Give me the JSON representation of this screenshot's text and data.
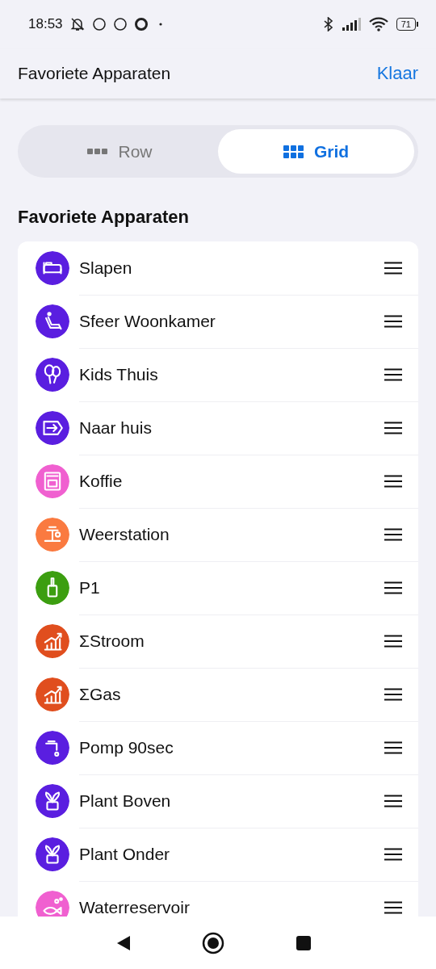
{
  "status_bar": {
    "time": "18:53",
    "battery": "71"
  },
  "header": {
    "title": "Favoriete Apparaten",
    "action": "Klaar"
  },
  "view_toggle": [
    {
      "label": "Row",
      "kind": "row",
      "selected": false
    },
    {
      "label": "Grid",
      "kind": "grid",
      "selected": true
    }
  ],
  "section_title": "Favoriete Apparaten",
  "devices": [
    {
      "name": "Slapen",
      "kind": "bed",
      "color": "#5a1ee0"
    },
    {
      "name": "Sfeer Woonkamer",
      "kind": "recliner",
      "color": "#5a1ee0"
    },
    {
      "name": "Kids Thuis",
      "kind": "balloon",
      "color": "#5a1ee0"
    },
    {
      "name": "Naar huis",
      "kind": "sign",
      "color": "#5a1ee0"
    },
    {
      "name": "Koffie",
      "kind": "coffee",
      "color": "#f060d0"
    },
    {
      "name": "Weerstation",
      "kind": "weather",
      "color": "#fa7a40"
    },
    {
      "name": "P1",
      "kind": "plug",
      "color": "#3c9e10"
    },
    {
      "name": "ΣStroom",
      "kind": "chart",
      "color": "#e04e1e"
    },
    {
      "name": "ΣGas",
      "kind": "chart",
      "color": "#e04e1e"
    },
    {
      "name": "Pomp 90sec",
      "kind": "tap",
      "color": "#5a1ee0"
    },
    {
      "name": "Plant Boven",
      "kind": "plant",
      "color": "#5a1ee0"
    },
    {
      "name": "Plant Onder",
      "kind": "plant",
      "color": "#5a1ee0"
    },
    {
      "name": "Waterreservoir",
      "kind": "fish",
      "color": "#f060d0"
    }
  ]
}
